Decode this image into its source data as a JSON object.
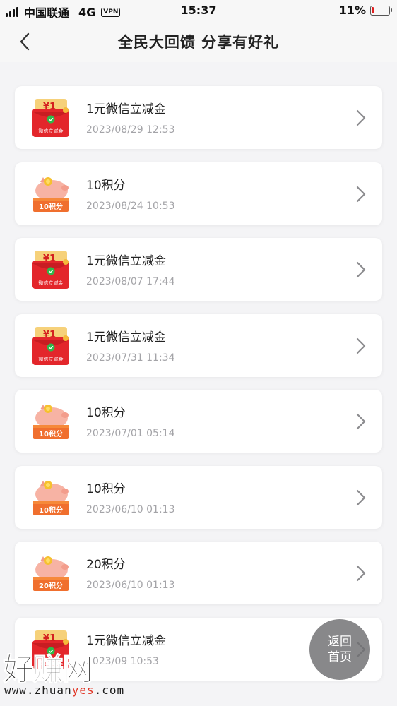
{
  "status_bar": {
    "carrier": "中国联通",
    "network": "4G",
    "vpn": "VPN",
    "time": "15:37",
    "battery_text": "11%",
    "battery_level": 0.11
  },
  "header": {
    "title": "全民大回馈 分享有好礼"
  },
  "rewards": [
    {
      "type": "red-envelope",
      "title": "1元微信立减金",
      "time": "2023/08/29 12:53",
      "badge_amount": "¥1",
      "badge_label": "微信立减金"
    },
    {
      "type": "points",
      "title": "10积分",
      "time": "2023/08/24 10:53",
      "badge_label": "10积分"
    },
    {
      "type": "red-envelope",
      "title": "1元微信立减金",
      "time": "2023/08/07 17:44",
      "badge_amount": "¥1",
      "badge_label": "微信立减金"
    },
    {
      "type": "red-envelope",
      "title": "1元微信立减金",
      "time": "2023/07/31 11:34",
      "badge_amount": "¥1",
      "badge_label": "微信立减金"
    },
    {
      "type": "points",
      "title": "10积分",
      "time": "2023/07/01 05:14",
      "badge_label": "10积分"
    },
    {
      "type": "points",
      "title": "10积分",
      "time": "2023/06/10 01:13",
      "badge_label": "10积分"
    },
    {
      "type": "points",
      "title": "20积分",
      "time": "2023/06/10 01:13",
      "badge_label": "20积分"
    },
    {
      "type": "red-envelope",
      "title": "1元微信立减金",
      "time": "2023/09 10:53",
      "badge_amount": "¥1",
      "badge_label": "微信立减金"
    }
  ],
  "home_button": {
    "line1": "返回",
    "line2": "首页"
  },
  "watermark": {
    "brand": "好赚网",
    "url_prefix": "www.zhuan",
    "url_highlight": "yes",
    "url_suffix": ".com"
  },
  "colors": {
    "accent_red": "#e8302a",
    "points_orange": "#f6893a",
    "muted_text": "#a4a4a8"
  }
}
